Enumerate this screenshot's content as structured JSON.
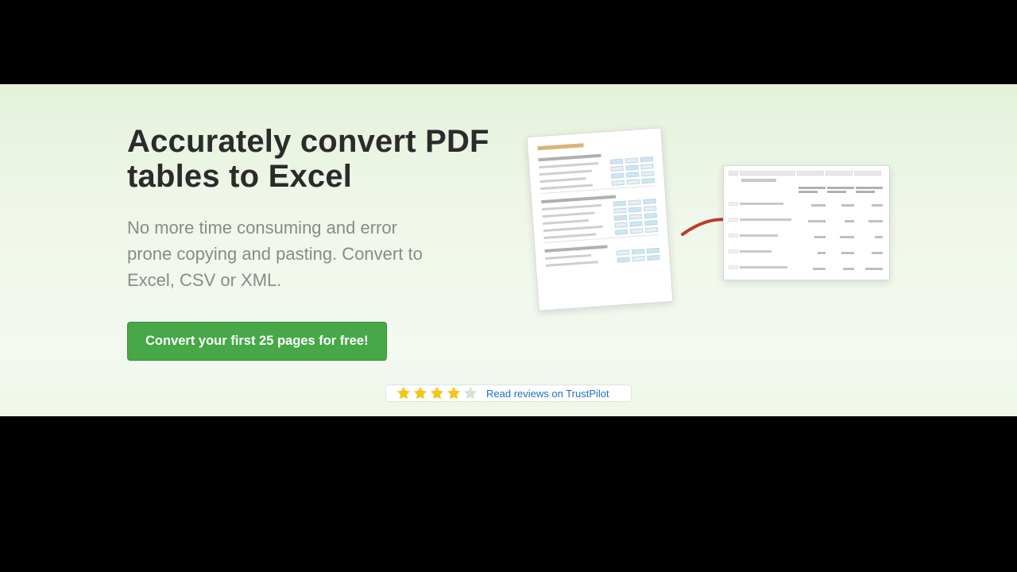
{
  "hero": {
    "headline": "Accurately convert PDF tables to Excel",
    "subhead": "No more time consuming and error prone copying and pasting. Convert to Excel, CSV or XML.",
    "cta_label": "Convert your first 25 pages for free!"
  },
  "reviews": {
    "link_text": "Read reviews on TrustPilot",
    "stars_filled": 4,
    "stars_total": 5
  },
  "illustration": {
    "source_type": "pdf-table-icon",
    "target_type": "excel-grid-icon",
    "arrow": "arrow-right-curved-icon"
  },
  "colors": {
    "cta_bg": "#46a846",
    "star_filled": "#f5c518",
    "star_empty": "#d8e4cf",
    "arrow": "#c0392b"
  }
}
